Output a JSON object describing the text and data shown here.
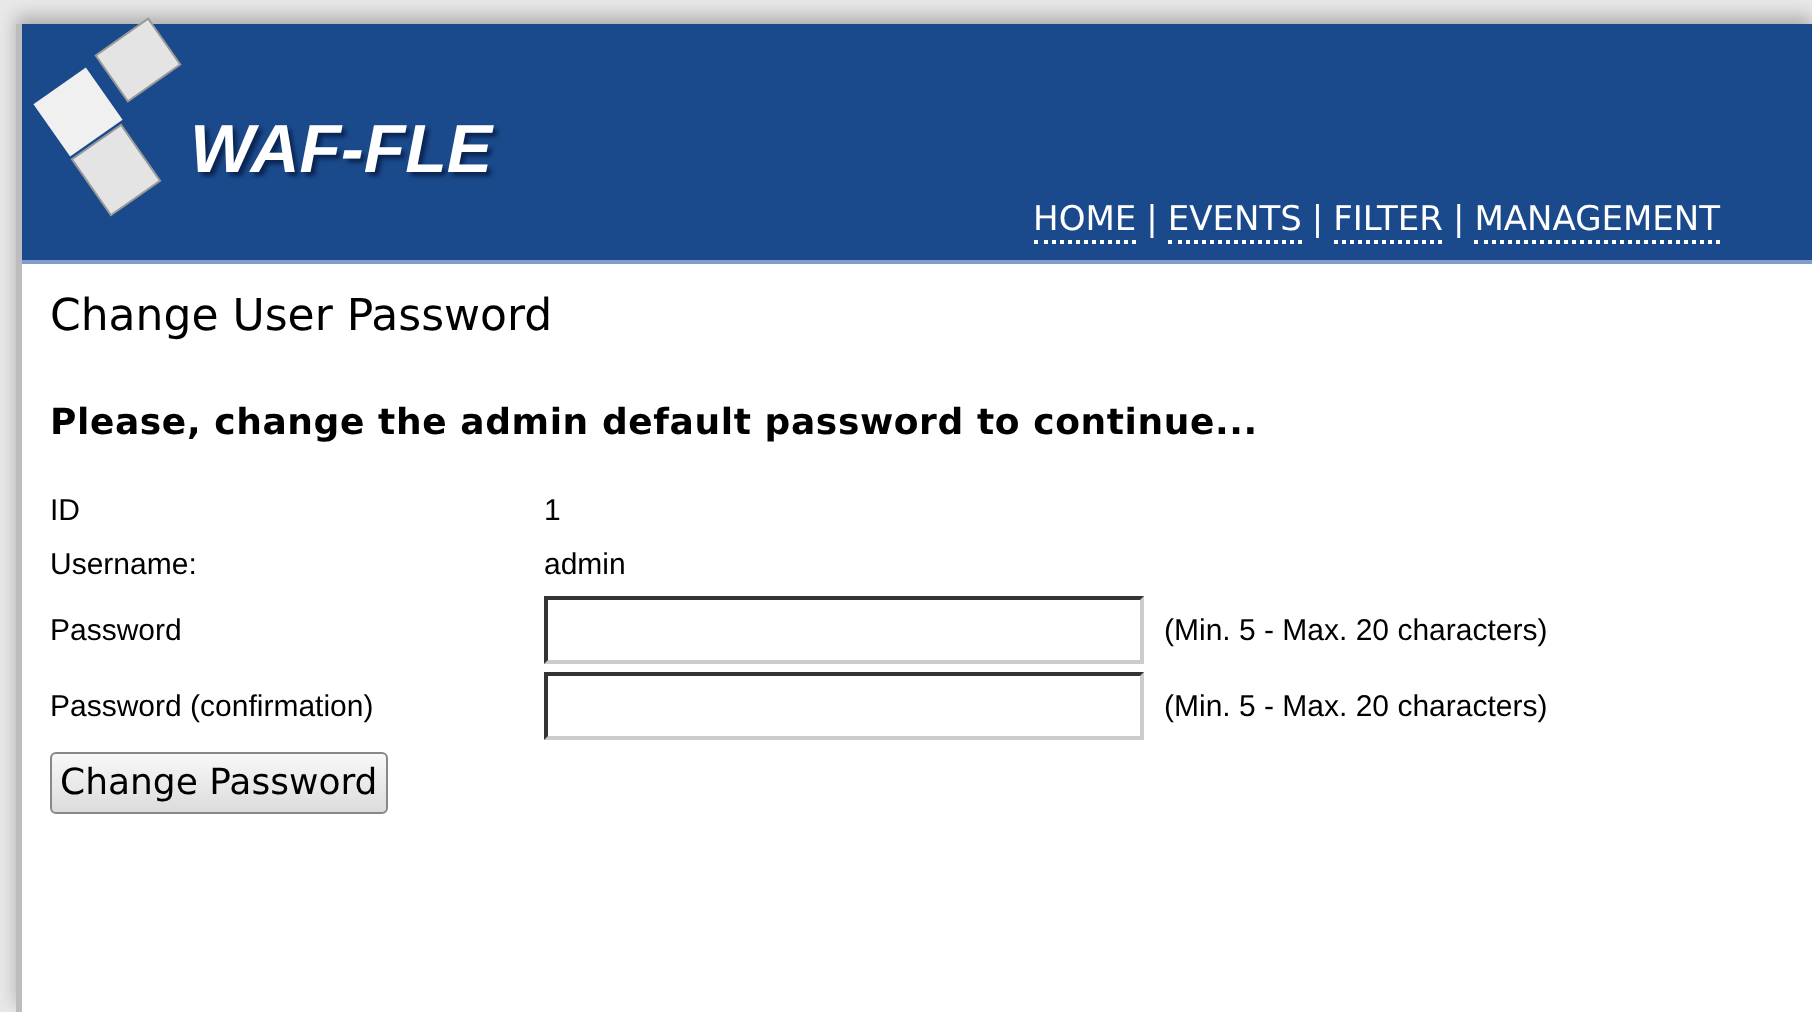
{
  "logo": {
    "text": "WAF-FLE"
  },
  "nav": [
    {
      "label": "HOME"
    },
    {
      "label": "EVENTS"
    },
    {
      "label": "FILTER"
    },
    {
      "label": "MANAGEMENT"
    }
  ],
  "nav_separator": "|",
  "title": "Change User Password",
  "notice": "Please, change the admin default password to continue...",
  "fields": [
    {
      "kind": "text",
      "label": "ID",
      "value": "1"
    },
    {
      "kind": "text",
      "label": "Username:",
      "value": "admin"
    },
    {
      "kind": "input",
      "label": "Password",
      "hint": "(Min. 5 - Max. 20 characters)"
    },
    {
      "kind": "input",
      "label": "Password (confirmation)",
      "hint": "(Min. 5 - Max. 20 characters)"
    }
  ],
  "submit": "Change Password"
}
